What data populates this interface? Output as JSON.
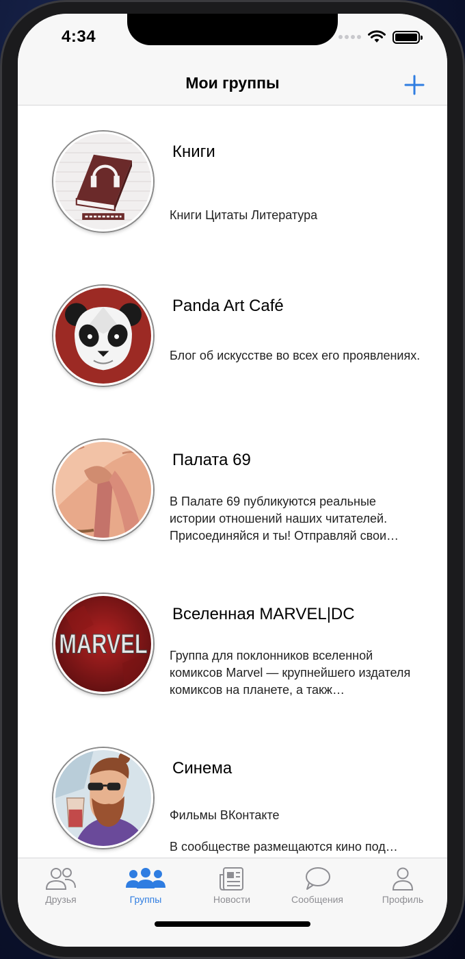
{
  "status_bar": {
    "time": "4:34"
  },
  "nav": {
    "title": "Мои группы",
    "add_icon": "plus-icon"
  },
  "groups": [
    {
      "name": "Книги",
      "description": "Книги Цитаты Литература",
      "avatar_icon": "audiobook-avatar"
    },
    {
      "name": "Panda Art Café",
      "description": "Блог об искусстве во всех его проявлениях.",
      "avatar_icon": "panda-avatar"
    },
    {
      "name": "Палата 69",
      "description": "В Палате 69 публикуются реальные истории отношений наших читателей. Присоединяйся и ты! Отправляй свои…",
      "avatar_icon": "illustration-avatar"
    },
    {
      "name": "Вселенная MARVEL|DC",
      "description": "Группа для поклонников вселенной комиксов Marvel — крупнейшего издателя комиксов на планете, а такж…",
      "avatar_icon": "marvel-avatar",
      "avatar_text": "MARVEL"
    },
    {
      "name": "Синема",
      "description": "Фильмы ВКонтакте",
      "description_2": "В сообществе размещаются кино под…",
      "avatar_icon": "bearded-man-avatar"
    }
  ],
  "tabs": [
    {
      "label": "Друзья",
      "icon": "friends-icon",
      "active": false
    },
    {
      "label": "Группы",
      "icon": "groups-icon",
      "active": true
    },
    {
      "label": "Новости",
      "icon": "news-icon",
      "active": false
    },
    {
      "label": "Сообщения",
      "icon": "messages-icon",
      "active": false
    },
    {
      "label": "Профиль",
      "icon": "profile-icon",
      "active": false
    }
  ],
  "colors": {
    "accent": "#2f7de1",
    "inactive": "#8e8e93"
  }
}
